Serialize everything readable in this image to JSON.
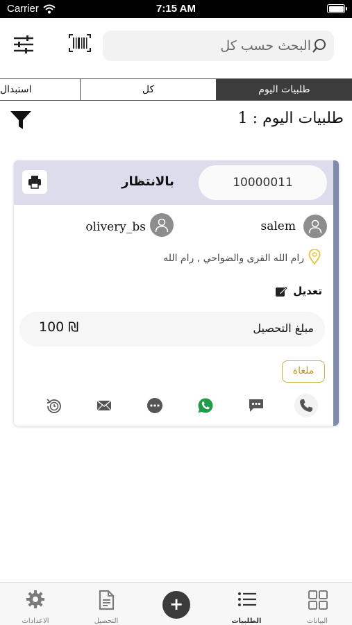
{
  "status_bar": {
    "carrier": "Carrier",
    "time": "7:15 AM"
  },
  "search": {
    "placeholder": "البحث حسب كل"
  },
  "tabs": [
    {
      "label": "استبدال"
    },
    {
      "label": "كل"
    },
    {
      "label": "طلبيات اليوم",
      "selected": true
    }
  ],
  "heading": "طلبيات اليوم : 1",
  "order": {
    "status": "بالانتظار",
    "number": "10000011",
    "customer_name": "salem",
    "driver_name": "olivery_bs",
    "address": "رام الله القرى والضواحي , رام الله",
    "edit_label": "تعديل",
    "amount_label": "مبلغ التحصيل",
    "amount_value": "100 ₪",
    "badge": "ملغاة"
  },
  "bottom_nav": {
    "settings": "الاعدادات",
    "collection": "التحصيل",
    "add": "+",
    "orders": "الطلبيات",
    "data": "البيانات"
  },
  "colors": {
    "card_header": "#dcdcec",
    "card_strip": "#7f8aa8",
    "badge_border": "#c9b13c",
    "whatsapp": "#1f9c46",
    "pin": "#e8c43a",
    "selected_tab": "#3c3c3c"
  }
}
